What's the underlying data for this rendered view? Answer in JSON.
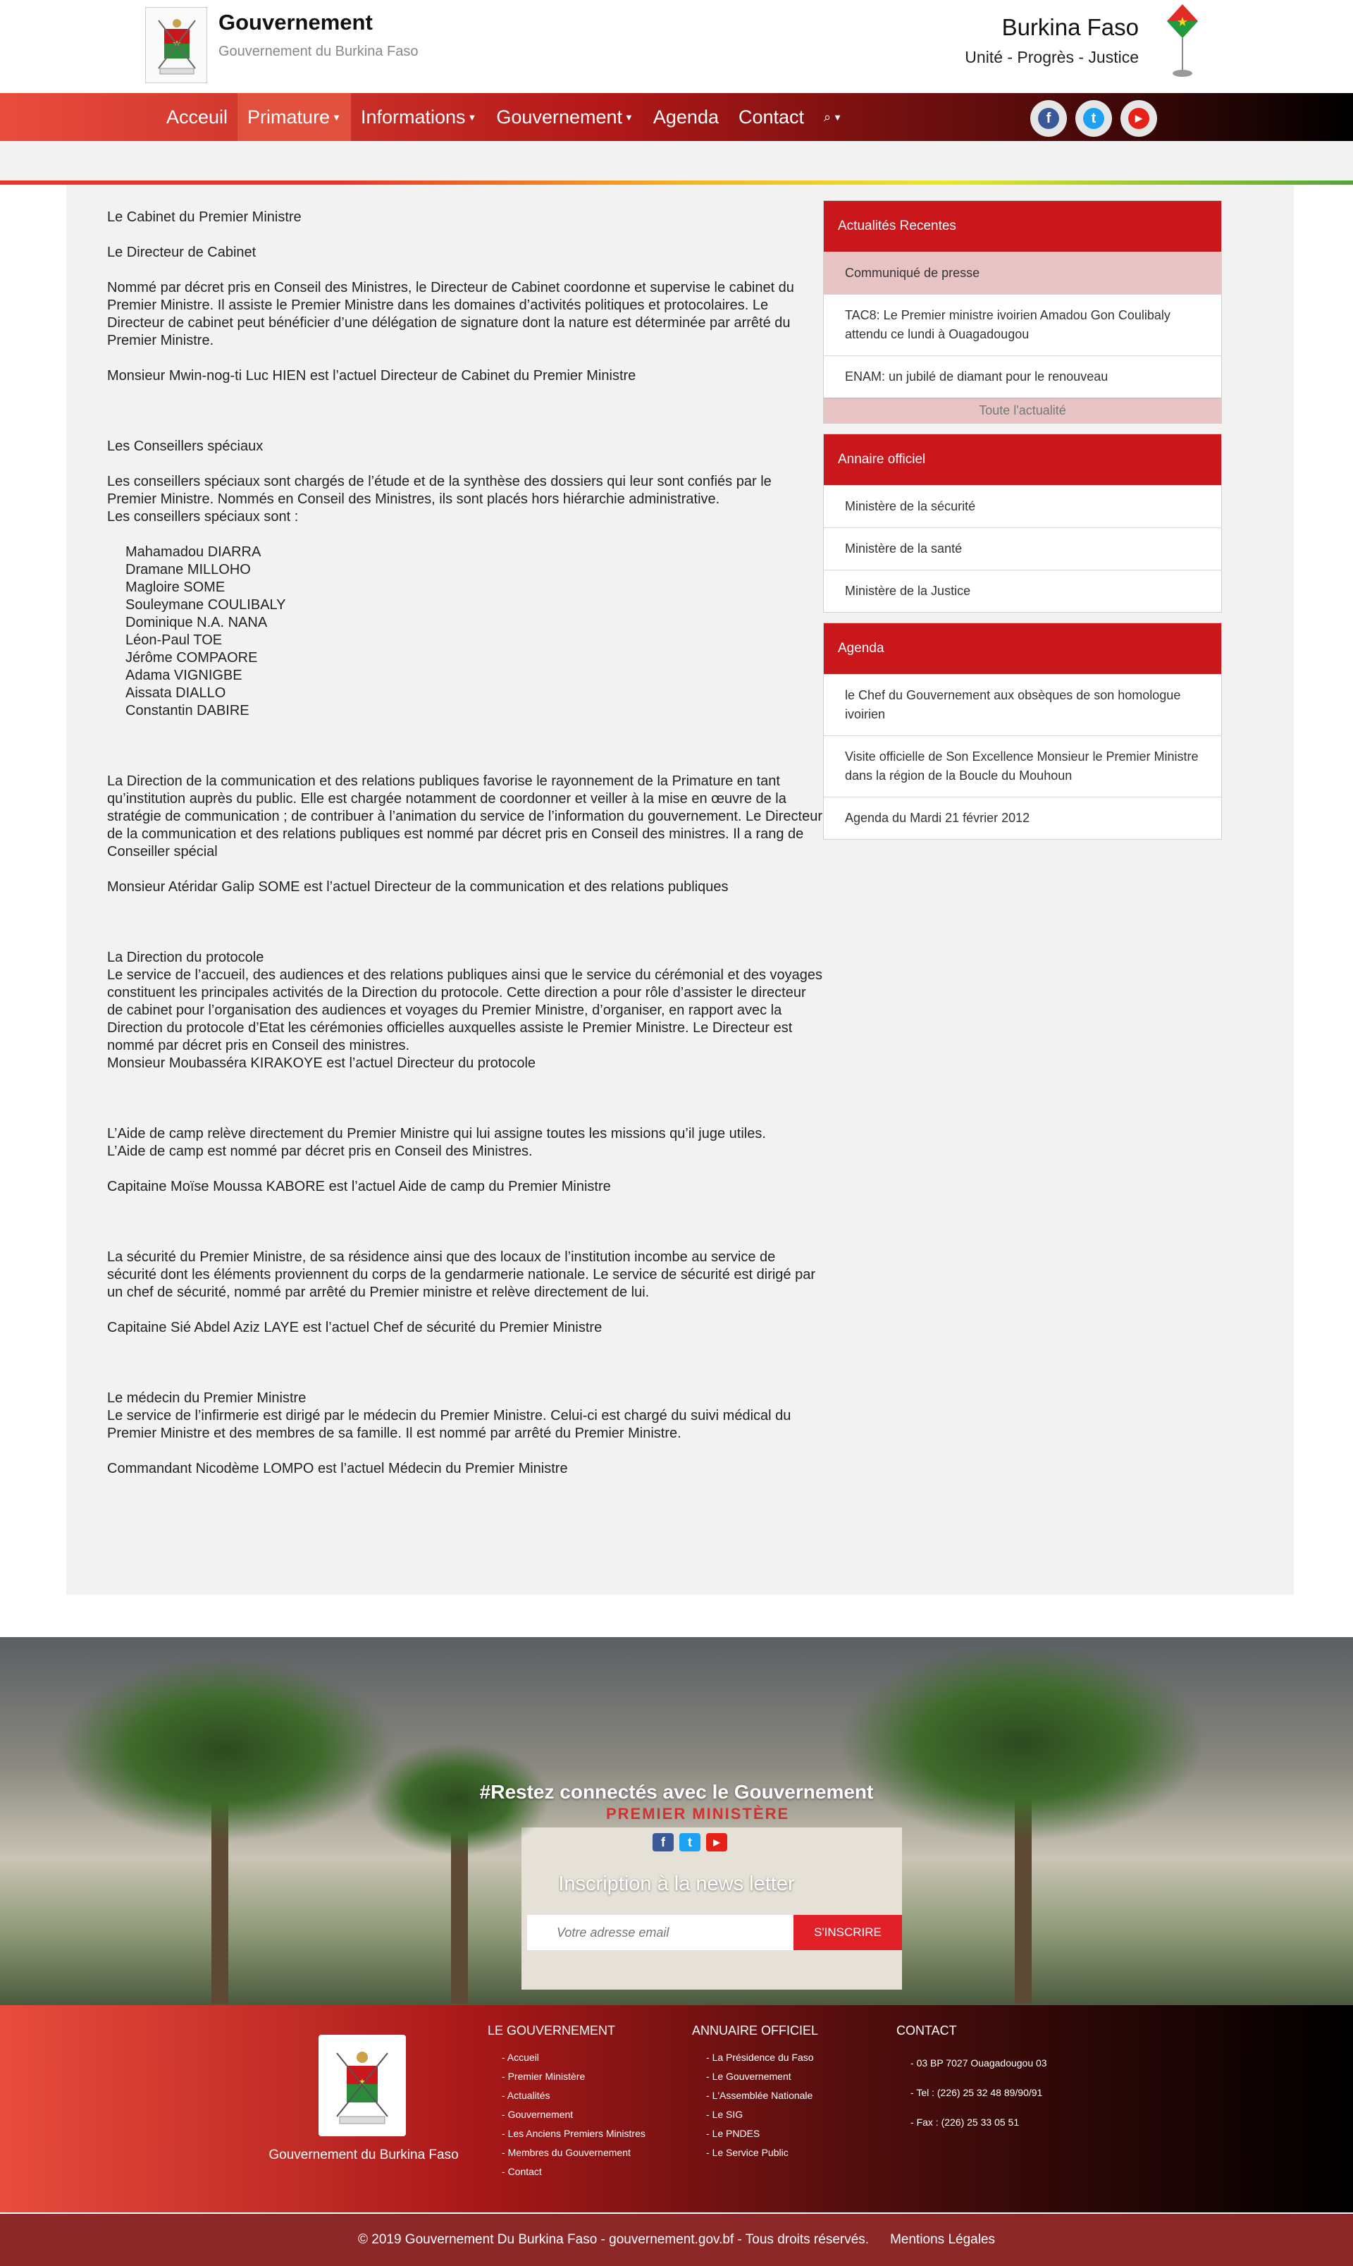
{
  "header": {
    "site_title": "Gouvernement",
    "site_subtitle": "Gouvernement du Burkina Faso",
    "country_name": "Burkina Faso",
    "motto": "Unité - Progrès - Justice"
  },
  "nav": {
    "items": [
      "Acceuil",
      "Primature",
      "Informations",
      "Gouvernement",
      "Agenda",
      "Contact"
    ],
    "search_icon": "search-icon"
  },
  "social": {
    "facebook": "f",
    "twitter": "t",
    "youtube": "▶"
  },
  "article": {
    "h1": "Le Cabinet du Premier Ministre",
    "h2": "Le Directeur de Cabinet",
    "p1": "Nommé par décret pris en Conseil des Ministres, le Directeur de Cabinet coordonne et supervise le cabinet du Premier Ministre. Il assiste le Premier Ministre dans les domaines d’activités politiques et protocolaires. Le Directeur de cabinet peut bénéficier d’une délégation de signature dont la nature est déterminée par arrêté du Premier Ministre.",
    "p2": "Monsieur Mwin-nog-ti Luc HIEN est l’actuel Directeur de Cabinet du Premier Ministre",
    "h3": "Les Conseillers spéciaux",
    "p3a": "Les conseillers spéciaux sont chargés de l’étude et de la synthèse des dossiers qui leur sont confiés par le Premier Ministre. Nommés en Conseil des Ministres, ils sont placés hors hiérarchie administrative.",
    "p3b": "Les conseillers spéciaux sont :",
    "advisors": [
      "Mahamadou DIARRA",
      "Dramane MILLOHO",
      "Magloire SOME",
      "Souleymane COULIBALY",
      "Dominique N.A. NANA",
      "Léon-Paul TOE",
      "Jérôme COMPAORE",
      "Adama VIGNIGBE",
      "Aissata DIALLO",
      "Constantin DABIRE"
    ],
    "p4": "La Direction de la communication et des relations publiques favorise le rayonnement de la Primature en tant qu’institution auprès du public. Elle est chargée notamment de coordonner et veiller à la mise en œuvre de la stratégie de communication ; de contribuer à l’animation du service de l’information du gouvernement. Le Directeur de la communication et des relations publiques est nommé par décret pris en Conseil des ministres. Il a rang de Conseiller spécial",
    "p5": "Monsieur Atéridar Galip SOME est l’actuel Directeur de la communication et des relations publiques",
    "h4": "La Direction du protocole",
    "p6": "Le service de l’accueil, des audiences et des relations publiques ainsi que le service du cérémonial et des voyages constituent les principales activités de la Direction du protocole. Cette direction a pour rôle d’assister le directeur de cabinet pour l’organisation des audiences et voyages du Premier Ministre, d’organiser, en rapport avec la Direction du protocole d’Etat les cérémonies officielles auxquelles assiste le Premier Ministre. Le Directeur est nommé par décret pris en Conseil des ministres.",
    "p6b": "Monsieur Moubasséra KIRAKOYE est l’actuel Directeur du protocole",
    "p7a": "L’Aide de camp relève directement du Premier Ministre qui lui assigne toutes les missions qu’il juge utiles.",
    "p7b": "L’Aide de camp est nommé par décret pris en Conseil des Ministres.",
    "p8": "Capitaine Moïse Moussa KABORE est l’actuel Aide de camp du Premier Ministre",
    "p9": "La sécurité du Premier Ministre, de sa résidence ainsi que des locaux de l’institution incombe au service de sécurité dont les éléments proviennent du corps de la gendarmerie nationale. Le service de sécurité est dirigé par un chef de sécurité, nommé par arrêté du Premier ministre et relève directement de lui.",
    "p10": "Capitaine Sié Abdel Aziz LAYE est l’actuel Chef de sécurité du Premier Ministre",
    "h5": "Le médecin du Premier Ministre",
    "p11": "Le service de l’infirmerie est dirigé par le médecin du Premier Ministre. Celui-ci est chargé du suivi médical du Premier Ministre et des membres de sa famille. Il est nommé par arrêté du Premier Ministre.",
    "p12": "Commandant Nicodème LOMPO est l’actuel Médecin du Premier Ministre"
  },
  "sidebar": {
    "news_title": "Actualités Recentes",
    "news": [
      "Communiqué de presse",
      "TAC8: Le Premier ministre ivoirien Amadou Gon Coulibaly attendu ce lundi à Ouagadougou",
      "ENAM: un jubilé de diamant pour le renouveau"
    ],
    "news_more": "Toute l'actualité",
    "annuaire_title": "Annaire officiel",
    "annuaire": [
      "Ministère de la sécurité",
      "Ministère de la santé",
      "Ministère de la Justice"
    ],
    "agenda_title": "Agenda",
    "agenda": [
      "le Chef du Gouvernement aux obsèques de son homologue ivoirien",
      "Visite officielle de Son Excellence Monsieur le Premier Ministre dans la région de la Boucle du Mouhoun",
      "Agenda du Mardi 21 février 2012"
    ]
  },
  "banner": {
    "sign": "PREMIER MINISTÈRE",
    "title": "#Restez connectés avec le Gouvernement",
    "news_title": "Inscription à la news letter",
    "email_placeholder": "Votre adresse email",
    "subscribe": "S'INSCRIRE"
  },
  "footer": {
    "logo_text": "Gouvernement du Burkina Faso",
    "col1_title": "LE GOUVERNEMENT",
    "col1": [
      "Accueil",
      "Premier Ministère",
      "Actualités",
      "Gouvernement",
      "Les Anciens Premiers Ministres",
      "Membres du Gouvernement",
      "Contact"
    ],
    "col2_title": "ANNUAIRE OFFICIEL",
    "col2": [
      "La Présidence du Faso",
      "Le Gouvernement",
      "L'Assemblée Nationale",
      "Le SIG",
      "Le PNDES",
      "Le Service Public"
    ],
    "col3_title": "CONTACT",
    "col3": [
      "03 BP 7027 Ouagadougou 03",
      "Tel : (226) 25 32 48 89/90/91",
      "Fax : (226) 25 33 05 51"
    ],
    "copyright": "© 2019 Gouvernement Du Burkina Faso - gouvernement.gov.bf - Tous droits réservés.",
    "legal": "Mentions Légales"
  }
}
